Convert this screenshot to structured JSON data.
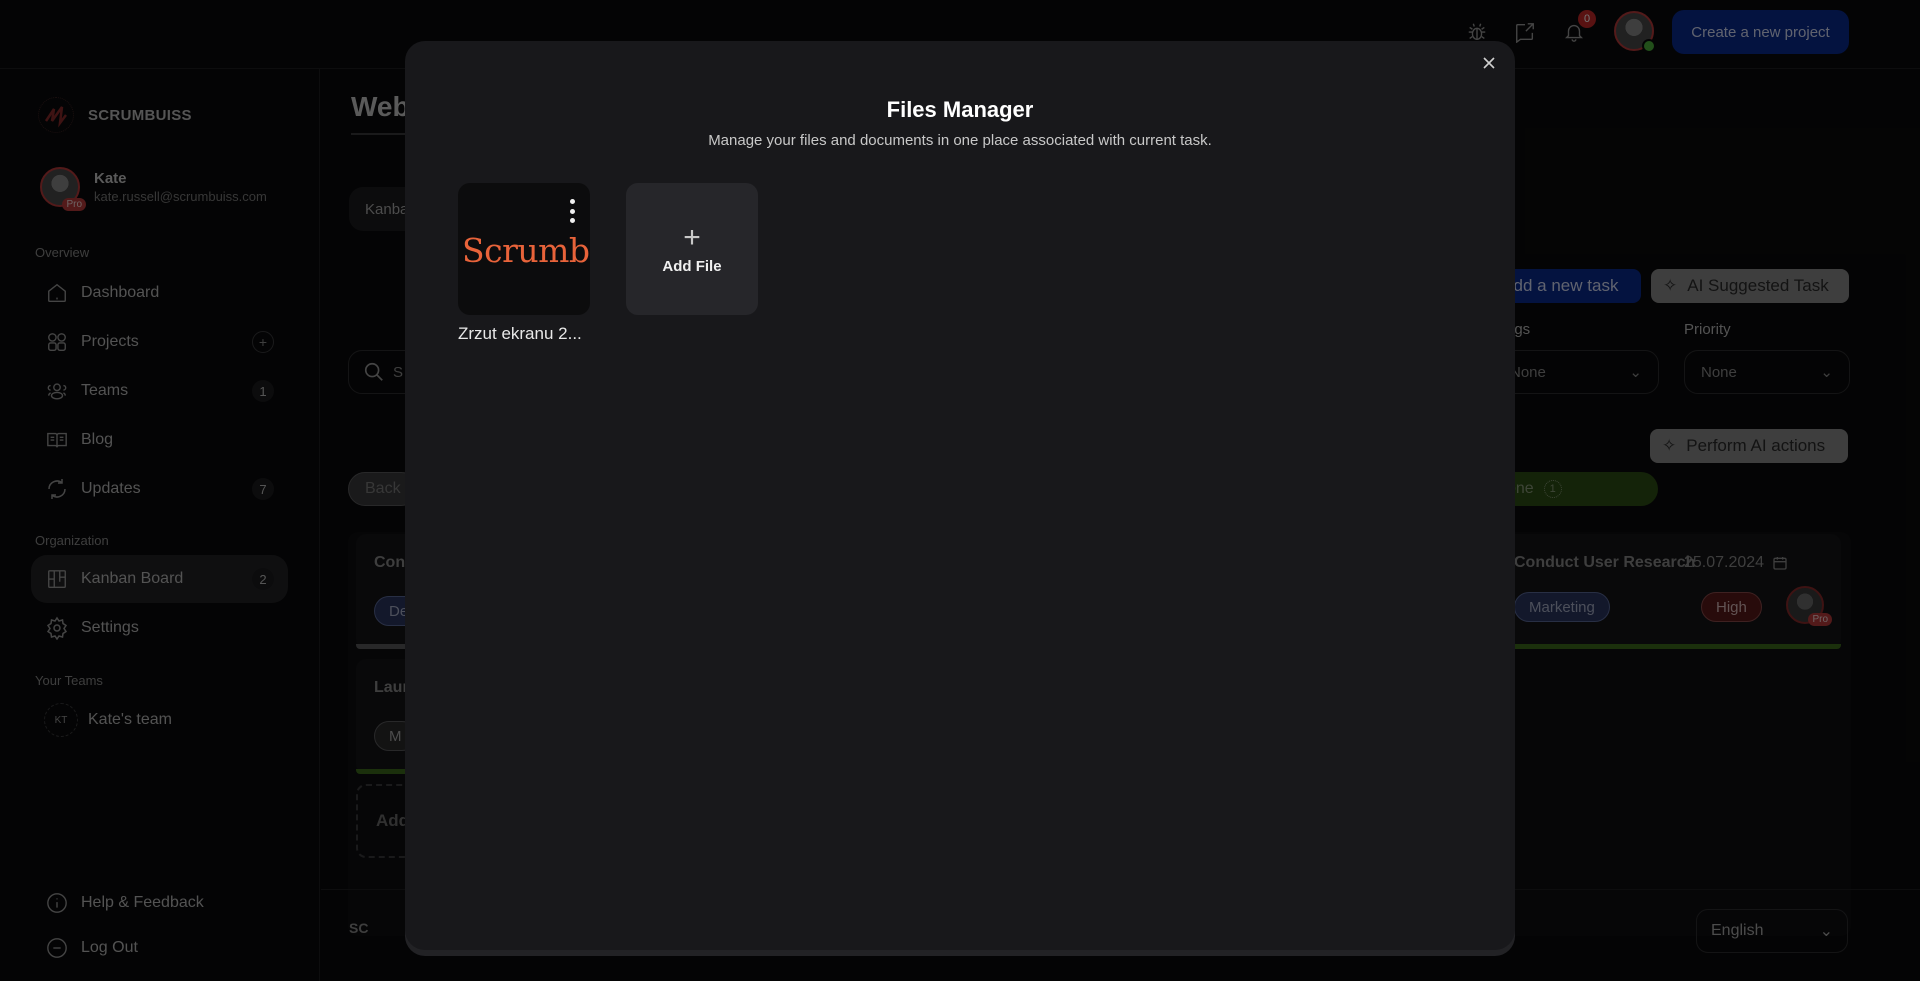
{
  "topbar": {
    "icons": [
      "bug-icon",
      "share-icon",
      "bell-icon"
    ],
    "notification_count": "0",
    "create_project_label": "Create a new project",
    "colors": {
      "primary": "#0a2a8f",
      "online": "#4caf3a",
      "badge": "#c62828"
    }
  },
  "sidebar": {
    "brand": "SCRUMBUISS",
    "user": {
      "name": "Kate",
      "email": "kate.russell@scrumbuiss.com",
      "badge": "Pro"
    },
    "overview_label": "Overview",
    "overview_items": [
      {
        "label": "Dashboard",
        "icon": "home-icon"
      },
      {
        "label": "Projects",
        "icon": "grid-icon",
        "action": "+"
      },
      {
        "label": "Teams",
        "icon": "users-icon",
        "count": "1"
      },
      {
        "label": "Blog",
        "icon": "book-icon"
      },
      {
        "label": "Updates",
        "icon": "refresh-icon",
        "count": "7"
      }
    ],
    "organization_label": "Organization",
    "organization_items": [
      {
        "label": "Kanban Board",
        "icon": "kanban-icon",
        "count": "2",
        "active": true
      },
      {
        "label": "Settings",
        "icon": "gear-icon"
      }
    ],
    "teams_label": "Your Teams",
    "teams": [
      {
        "initials": "KT",
        "name": "Kate's team"
      }
    ],
    "help_label": "Help & Feedback",
    "logout_label": "Log Out"
  },
  "main": {
    "title": "Web",
    "view_tab": "Kanba",
    "search_placeholder": "S",
    "add_task_label": "dd a new task",
    "ai_suggested_label": "AI Suggested Task",
    "perform_ai_label": "Perform AI actions",
    "filters": [
      {
        "label": "ags",
        "value": "None"
      },
      {
        "label": "Priority",
        "value": "None"
      }
    ],
    "columns": [
      {
        "label": "Back"
      },
      {
        "label": "one",
        "count": "1"
      }
    ],
    "left_cards": [
      {
        "title": "Cont",
        "tag": "De"
      },
      {
        "title": "Laur",
        "tag": "M"
      }
    ],
    "add_card_label": "Add",
    "done_card": {
      "title": "Conduct User Research",
      "date": "25.07.2024",
      "tag": "Marketing",
      "priority": "High",
      "badge": "Pro"
    },
    "footer": {
      "brand": "SC",
      "language": "English"
    }
  },
  "modal": {
    "title": "Files Manager",
    "subtitle": "Manage your files and documents in one place associated with current task.",
    "files": [
      {
        "name": "Zrzut ekranu 2...",
        "thumb_text": "Scrumbuiss"
      }
    ],
    "add_file_label": "Add File",
    "add_file_icon": "+",
    "colors": {
      "background": "#18181b",
      "tile": "#26262a",
      "thumb_accent": "#e8633a"
    }
  }
}
